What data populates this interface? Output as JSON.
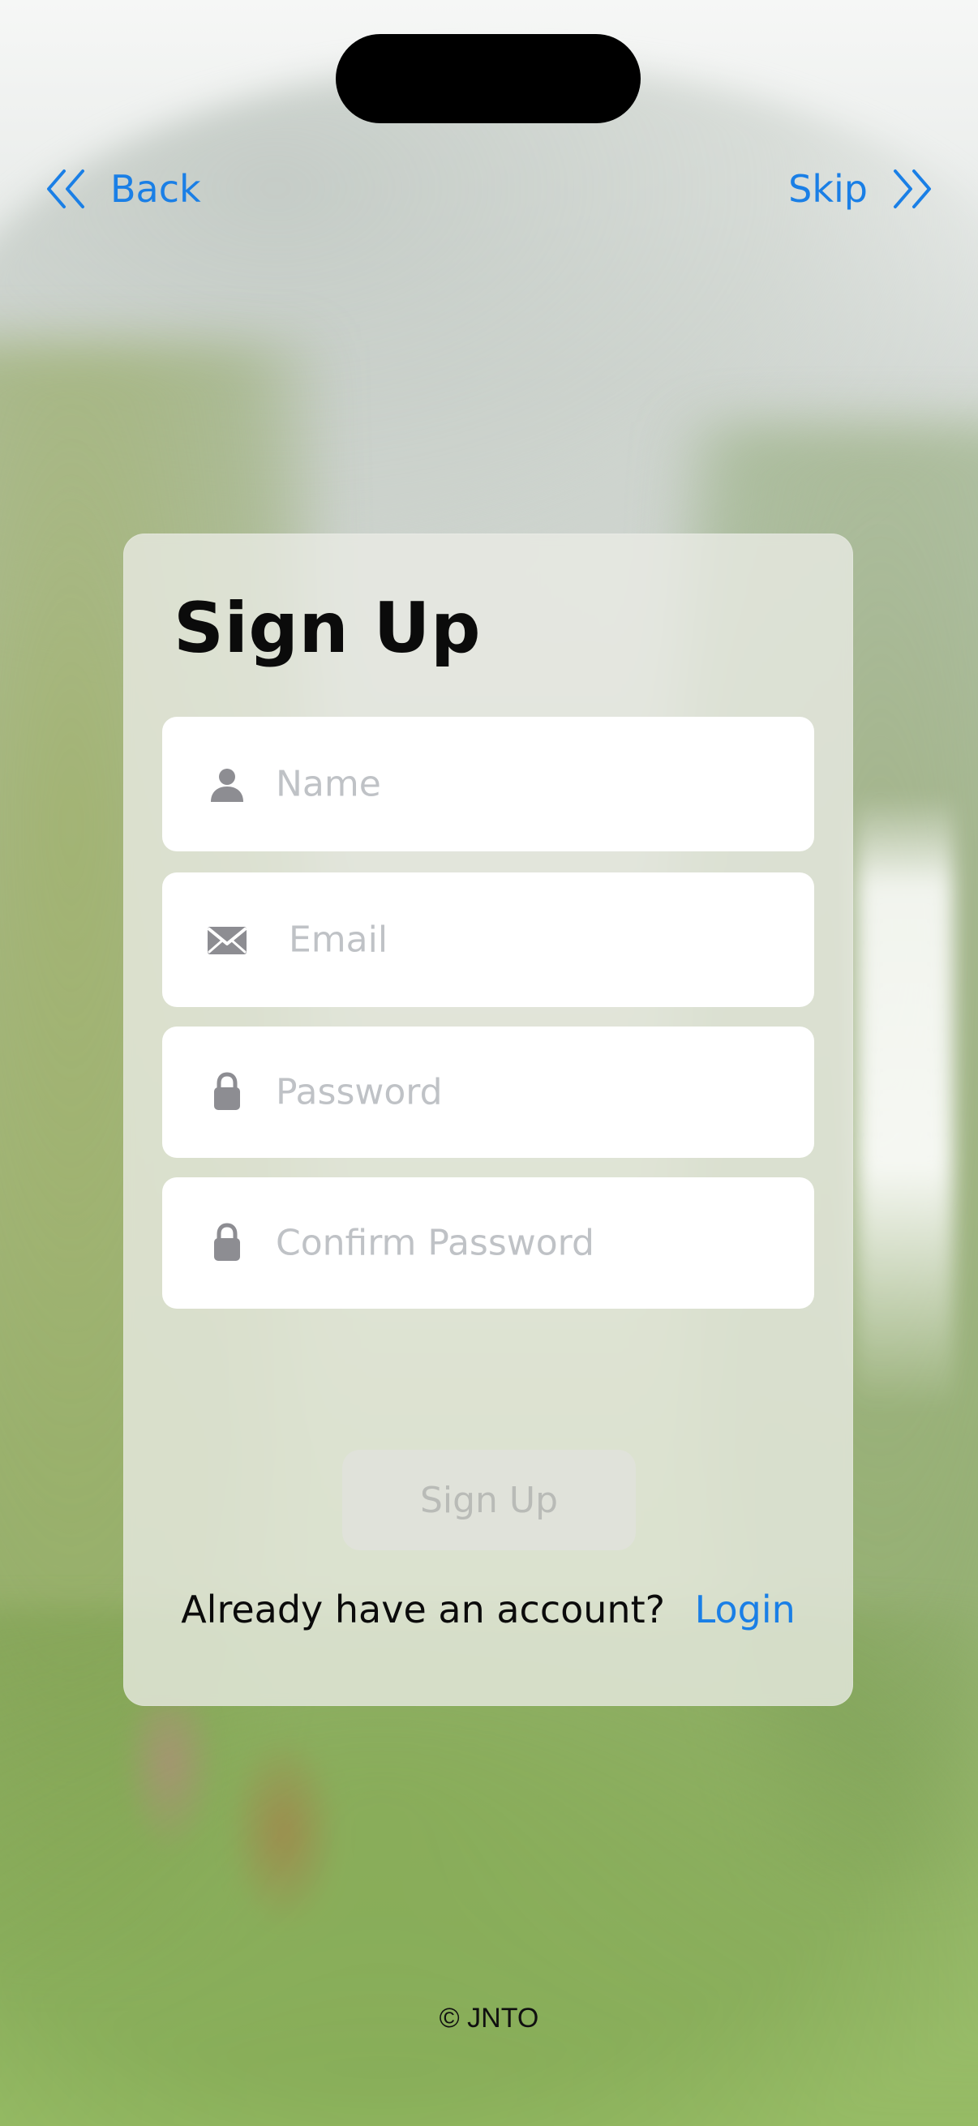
{
  "nav": {
    "back_label": "Back",
    "skip_label": "Skip",
    "back_icon": "double-chevron-left-icon",
    "skip_icon": "double-chevron-right-icon",
    "accent_color": "#1A7FE6"
  },
  "signup": {
    "title": "Sign Up",
    "fields": {
      "name": {
        "placeholder": "Name",
        "icon": "person-icon"
      },
      "email": {
        "placeholder": "Email",
        "icon": "mail-icon"
      },
      "password": {
        "placeholder": "Password",
        "icon": "lock-icon"
      },
      "confirm_password": {
        "placeholder": "Confirm Password",
        "icon": "lock-icon"
      }
    },
    "submit_label": "Sign Up",
    "already_text": "Already have an account?",
    "login_label": "Login"
  },
  "footer": {
    "copyright": "© JNTO"
  }
}
